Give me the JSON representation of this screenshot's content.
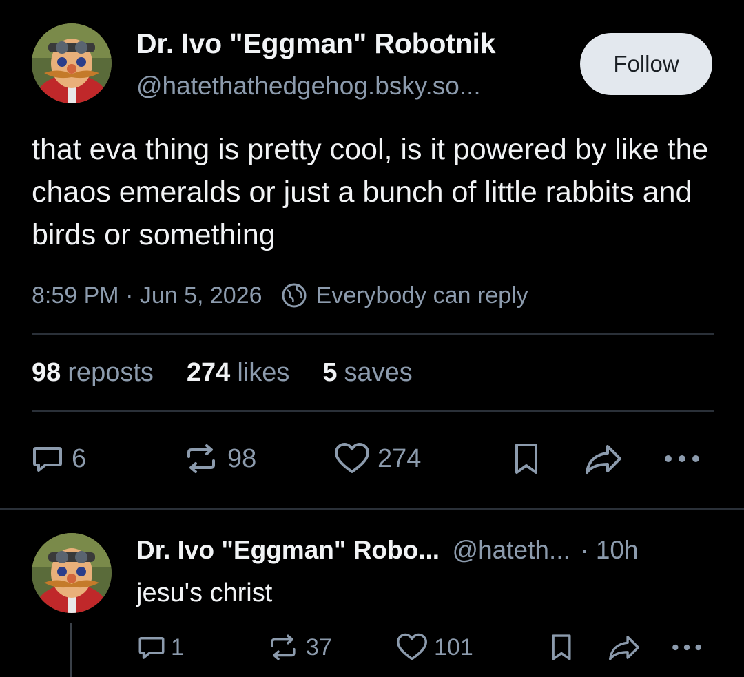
{
  "post": {
    "display_name": "Dr. Ivo \"Eggman\" Robotnik",
    "handle": "@hatethathedgehog.bsky.so...",
    "follow_label": "Follow",
    "text": "that eva thing is pretty cool, is it powered by like the chaos emeralds or just a bunch of little rabbits and birds or something",
    "timestamp": "8:59 PM · Jun 5, 2026",
    "reply_setting": "Everybody can reply",
    "stats": {
      "reposts_count": "98",
      "reposts_label": "reposts",
      "likes_count": "274",
      "likes_label": "likes",
      "saves_count": "5",
      "saves_label": "saves"
    },
    "actions": {
      "reply_count": "6",
      "repost_count": "98",
      "like_count": "274"
    }
  },
  "reply": {
    "display_name": "Dr. Ivo \"Eggman\" Robo...",
    "handle": "@hateth...",
    "age": "· 10h",
    "text": "jesu's christ",
    "actions": {
      "reply_count": "1",
      "repost_count": "37",
      "like_count": "101"
    }
  },
  "colors": {
    "background": "#000000",
    "text": "#f1f3f5",
    "muted": "#8c9bad",
    "follow_bg": "#e3e8ee",
    "divider": "#2a3038"
  },
  "icons": [
    "avatar",
    "globe-icon",
    "reply-icon",
    "repost-icon",
    "heart-icon",
    "bookmark-icon",
    "share-icon",
    "more-icon"
  ]
}
